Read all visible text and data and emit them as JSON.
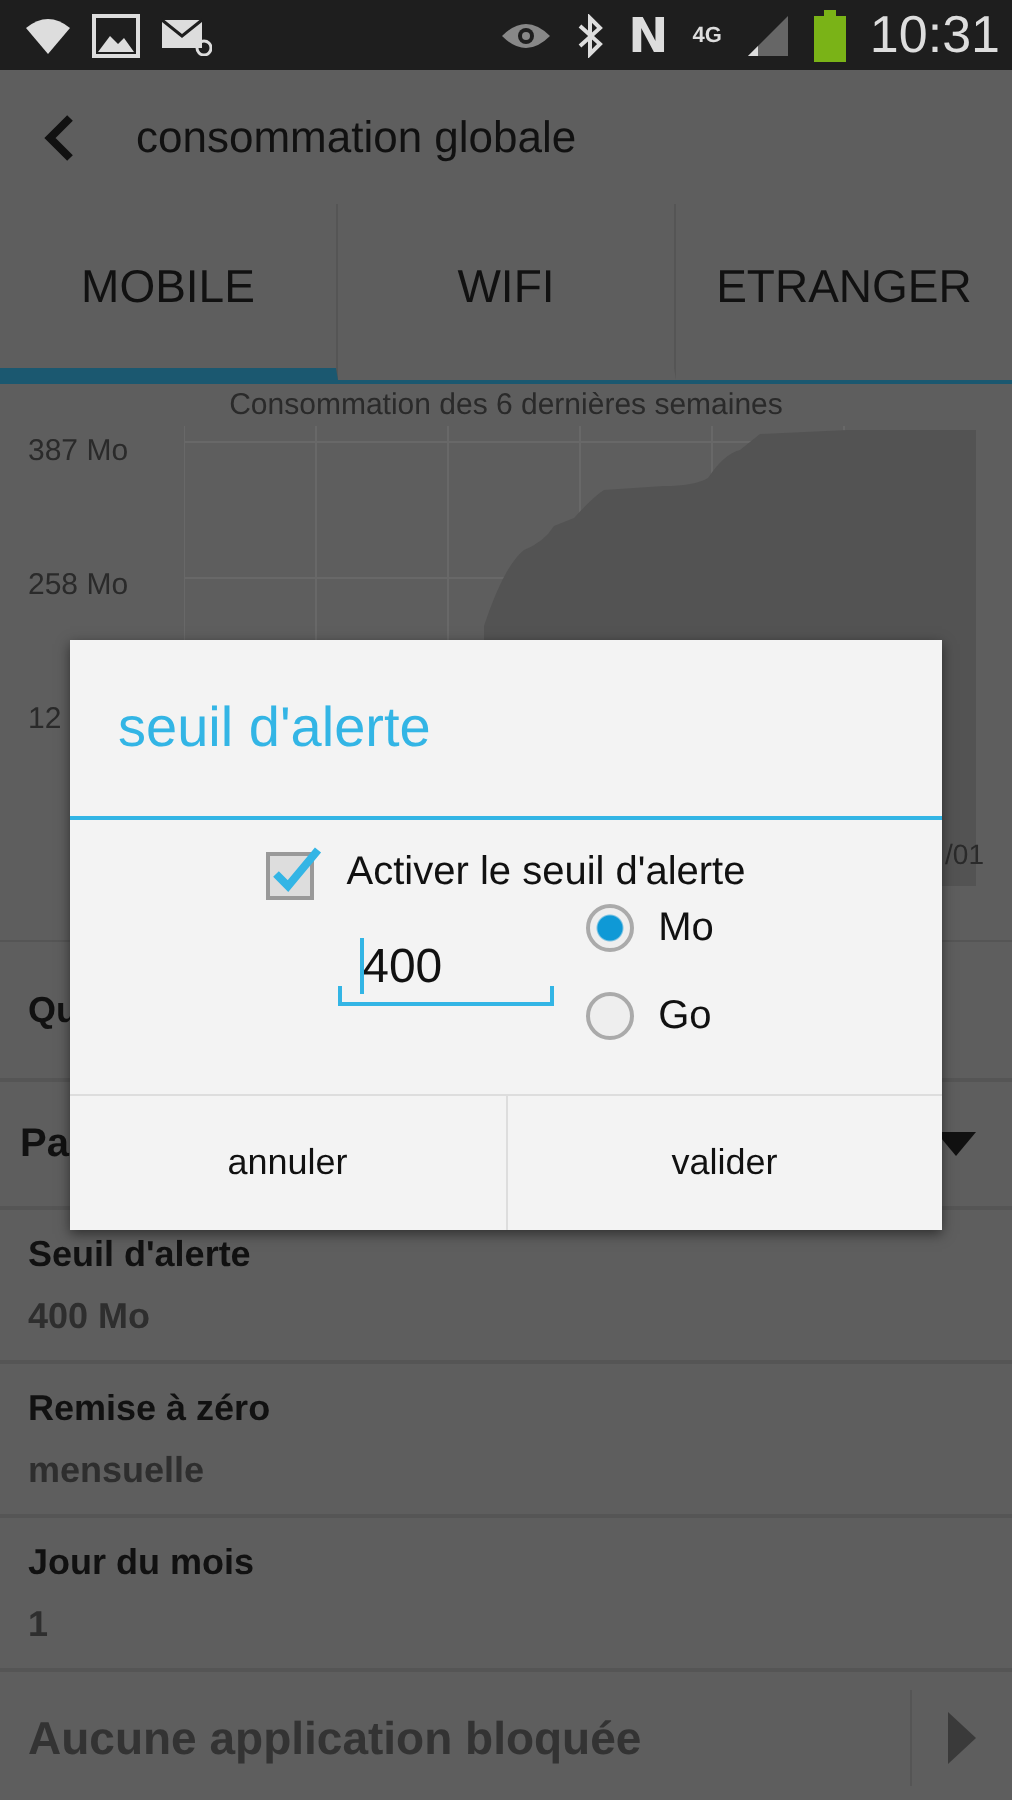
{
  "status_bar": {
    "time": "10:31",
    "network": "4G",
    "carrier_badge": "N"
  },
  "action_bar": {
    "title": "consommation globale"
  },
  "tabs": [
    {
      "label": "MOBILE",
      "selected": true
    },
    {
      "label": "WIFI",
      "selected": false
    },
    {
      "label": "ETRANGER",
      "selected": false
    }
  ],
  "chart": {
    "title": "Consommation des 6 dernières semaines",
    "y_labels": [
      "387 Mo",
      "258 Mo",
      "12"
    ],
    "x_label_end": "/01"
  },
  "quota_row": {
    "label": "Qu"
  },
  "section": {
    "label": "Pa",
    "expanded": true
  },
  "settings": [
    {
      "label": "Seuil d'alerte",
      "value": "400 Mo"
    },
    {
      "label": "Remise à zéro",
      "value": "mensuelle"
    },
    {
      "label": "Jour du mois",
      "value": "1"
    }
  ],
  "blocked_apps": {
    "label": "Aucune application bloquée"
  },
  "dialog": {
    "title": "seuil d'alerte",
    "checkbox": {
      "label": "Activer le seuil d'alerte",
      "checked": true
    },
    "amount": {
      "value": "400"
    },
    "units": [
      {
        "label": "Mo",
        "selected": true
      },
      {
        "label": "Go",
        "selected": false
      }
    ],
    "buttons": [
      "annuler",
      "valider"
    ]
  }
}
